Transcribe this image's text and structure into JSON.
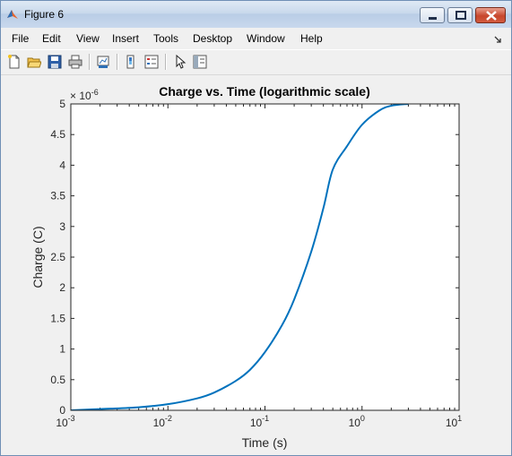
{
  "window": {
    "title": "Figure 6",
    "controls": {
      "minimize": "minimize",
      "maximize": "maximize",
      "close": "close"
    }
  },
  "menubar": {
    "items": [
      "File",
      "Edit",
      "View",
      "Insert",
      "Tools",
      "Desktop",
      "Window",
      "Help"
    ]
  },
  "toolbar": {
    "icons": [
      "new-figure-icon",
      "open-file-icon",
      "save-icon",
      "print-icon",
      "link-plot-icon",
      "colorbar-icon",
      "legend-icon",
      "pointer-icon",
      "property-editor-icon"
    ]
  },
  "colors": {
    "line": "#0072bd",
    "axes_bg": "#ffffff",
    "figure_bg": "#f0f0f0"
  },
  "chart_data": {
    "type": "line",
    "title": "Charge vs. Time (logarithmic scale)",
    "xlabel": "Time (s)",
    "ylabel": "Charge (C)",
    "x_scale": "log",
    "xlim": [
      0.001,
      10
    ],
    "ylim": [
      0,
      5e-06
    ],
    "y_exponent_label": "× 10",
    "y_exponent": "-6",
    "x_ticks": [
      {
        "value": 0.001,
        "base": "10",
        "exp": "-3"
      },
      {
        "value": 0.01,
        "base": "10",
        "exp": "-2"
      },
      {
        "value": 0.1,
        "base": "10",
        "exp": "-1"
      },
      {
        "value": 1,
        "base": "10",
        "exp": "0"
      },
      {
        "value": 10,
        "base": "10",
        "exp": "1"
      }
    ],
    "y_ticks": [
      {
        "value": 0,
        "label": "0"
      },
      {
        "value": 5e-07,
        "label": "0.5"
      },
      {
        "value": 1e-06,
        "label": "1"
      },
      {
        "value": 1.5e-06,
        "label": "1.5"
      },
      {
        "value": 2e-06,
        "label": "2"
      },
      {
        "value": 2.5e-06,
        "label": "2.5"
      },
      {
        "value": 3e-06,
        "label": "3"
      },
      {
        "value": 3.5e-06,
        "label": "3.5"
      },
      {
        "value": 4e-06,
        "label": "4"
      },
      {
        "value": 4.5e-06,
        "label": "4.5"
      },
      {
        "value": 5e-06,
        "label": "5"
      }
    ],
    "series": [
      {
        "x": [
          0.001,
          0.002,
          0.005,
          0.01,
          0.02,
          0.03,
          0.05,
          0.07,
          0.1,
          0.15,
          0.2,
          0.3,
          0.4,
          0.5,
          0.7,
          1,
          1.5,
          2,
          3
        ],
        "y": [
          0,
          2e-08,
          5e-08,
          1e-07,
          1.95e-07,
          2.9e-07,
          4.8e-07,
          6.6e-07,
          9.5e-07,
          1.39e-06,
          1.81e-06,
          2.59e-06,
          3.3e-06,
          3.93e-06,
          4.31e-06,
          4.66e-06,
          4.89e-06,
          4.97e-06,
          5e-06
        ]
      }
    ]
  }
}
